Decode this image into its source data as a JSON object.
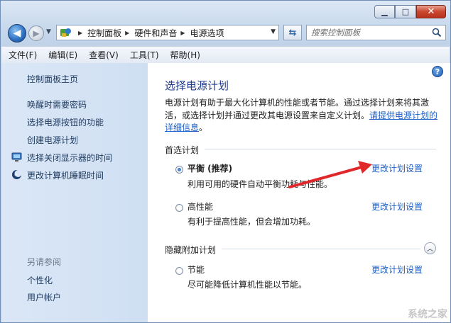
{
  "address": {
    "crumbs": [
      "控制面板",
      "硬件和声音",
      "电源选项"
    ]
  },
  "search": {
    "placeholder": "搜索控制面板"
  },
  "menu": [
    "文件(F)",
    "编辑(E)",
    "查看(V)",
    "工具(T)",
    "帮助(H)"
  ],
  "sidebar": {
    "home": "控制面板主页",
    "items": [
      "唤醒时需要密码",
      "选择电源按钮的功能",
      "创建电源计划",
      "选择关闭显示器的时间",
      "更改计算机睡眠时间"
    ],
    "see_also_title": "另请参阅",
    "see_also": [
      "个性化",
      "用户帐户"
    ]
  },
  "main": {
    "title": "选择电源计划",
    "desc_text": "电源计划有助于最大化计算机的性能或者节能。通过选择计划来将其激活，或选择计划并通过更改其电源设置来自定义计划。",
    "desc_link": "请提供电源计划的详细信息",
    "desc_end": "。",
    "preferred_header": "首选计划",
    "hidden_header": "隐藏附加计划",
    "change_link": "更改计划设置",
    "plans": [
      {
        "name": "平衡 (推荐)",
        "desc": "利用可用的硬件自动平衡功耗与性能。",
        "selected": true
      },
      {
        "name": "高性能",
        "desc": "有利于提高性能，但会增加功耗。",
        "selected": false
      },
      {
        "name": "节能",
        "desc": "尽可能降低计算机性能以节能。",
        "selected": false
      }
    ]
  },
  "colors": {
    "link": "#1e5fc8",
    "arrow": "#e0282b",
    "title": "#1e3a8c"
  },
  "watermark": "系统之家"
}
